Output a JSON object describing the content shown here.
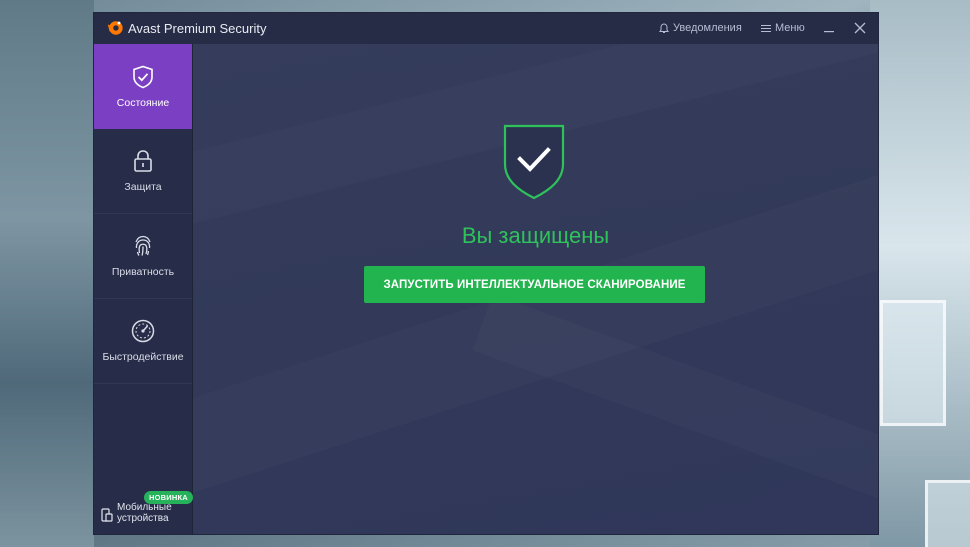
{
  "app": {
    "title": "Avast Premium Security"
  },
  "titlebar": {
    "notifications_label": "Уведомления",
    "menu_label": "Меню"
  },
  "sidebar": {
    "items": [
      {
        "label": "Состояние",
        "icon": "shield-check-icon",
        "active": true
      },
      {
        "label": "Защита",
        "icon": "lock-icon",
        "active": false
      },
      {
        "label": "Приватность",
        "icon": "fingerprint-icon",
        "active": false
      },
      {
        "label": "Быстродействие",
        "icon": "speedometer-icon",
        "active": false
      }
    ],
    "mobile": {
      "badge": "НОВИНКА",
      "label_line1": "Мобильные",
      "label_line2": "устройства",
      "icon": "mobile-device-icon"
    }
  },
  "main": {
    "status_text": "Вы защищены",
    "scan_button_label": "ЗАПУСТИТЬ ИНТЕЛЛЕКТУАЛЬНОЕ СКАНИРОВАНИЕ"
  },
  "colors": {
    "accent_purple": "#7a3fc2",
    "status_green": "#2fc25b",
    "button_green": "#22b44e",
    "window_bg": "#333a59",
    "sidebar_bg": "#272d48"
  }
}
